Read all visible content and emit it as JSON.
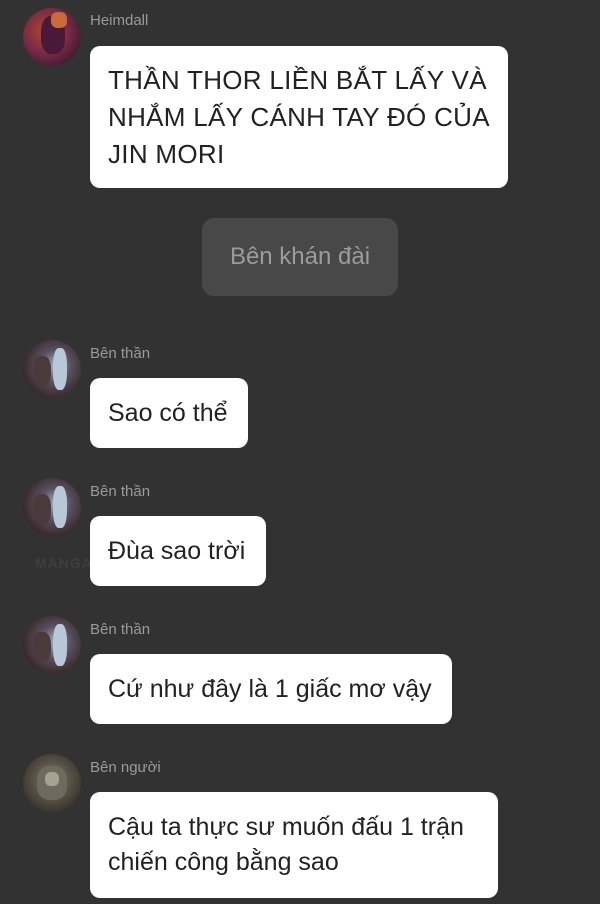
{
  "messages": [
    {
      "sender": "Heimdall",
      "text": "THẦN THOR LIỀN BẮT LẤY VÀ NHẮM LẤY CÁNH TAY ĐÓ CỦA JIN MORI"
    },
    {
      "system": "Bên khán đài"
    },
    {
      "sender": "Bên thần",
      "text": "Sao có thể"
    },
    {
      "sender": "Bên thần",
      "text": "Đùa sao trời"
    },
    {
      "sender": "Bên thần",
      "text": "Cứ như đây là 1 giấc mơ vậy"
    },
    {
      "sender": "Bên người",
      "text": "Cậu ta thực sư muốn đấu 1 trận chiến công bằng sao"
    }
  ],
  "watermark": "MANGA TOON"
}
